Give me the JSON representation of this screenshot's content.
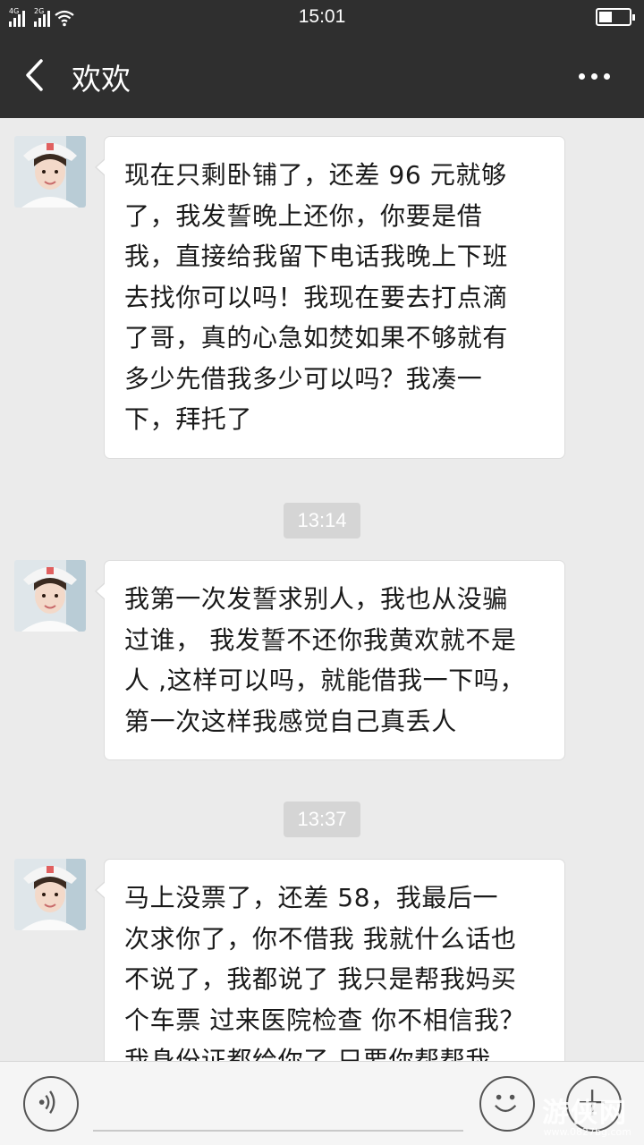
{
  "status_bar": {
    "sim1": "4G",
    "sim2": "2G",
    "time": "15:01",
    "battery_level": 0.4
  },
  "header": {
    "back_icon": "chevron-left-icon",
    "title": "欢欢",
    "more_icon": "more-dots-icon"
  },
  "messages": [
    {
      "type": "received",
      "lines": [
        "现在只剩卧铺了，还差 96 元就够",
        "了，我发誓晚上还你，你要是借",
        "我，直接给我留下电话我晚上下班",
        "去找你可以吗！我现在要去打点滴",
        "了哥，真的心急如焚如果不够就有",
        "多少先借我多少可以吗？我凑一",
        "下，拜托了"
      ]
    },
    {
      "type": "timestamp",
      "text": "13:14"
    },
    {
      "type": "received",
      "lines": [
        "我第一次发誓求别人，我也从没骗",
        "过谁， 我发誓不还你我黄欢就不是",
        "人 ,这样可以吗，就能借我一下吗，",
        "第一次这样我感觉自己真丢人"
      ]
    },
    {
      "type": "timestamp",
      "text": "13:37"
    },
    {
      "type": "received",
      "lines": [
        "马上没票了，还差 58，我最后一",
        "次求你了，你不借我 我就什么话也",
        "不说了，我都说了 我只是帮我妈买",
        "个车票 过来医院检查 你不相信我？",
        "我身份证都给你了 只要你帮帮我"
      ]
    }
  ],
  "input_bar": {
    "voice_icon": "voice-icon",
    "emoji_icon": "emoji-icon",
    "plus_icon": "plus-icon",
    "watermark": "游侠网",
    "watermark_url": "www.0827bg.com"
  },
  "colors": {
    "header_bg": "#2f2f2f",
    "chat_bg": "#ebebeb",
    "bubble_bg": "#ffffff",
    "timestamp_bg": "#d5d5d5"
  }
}
